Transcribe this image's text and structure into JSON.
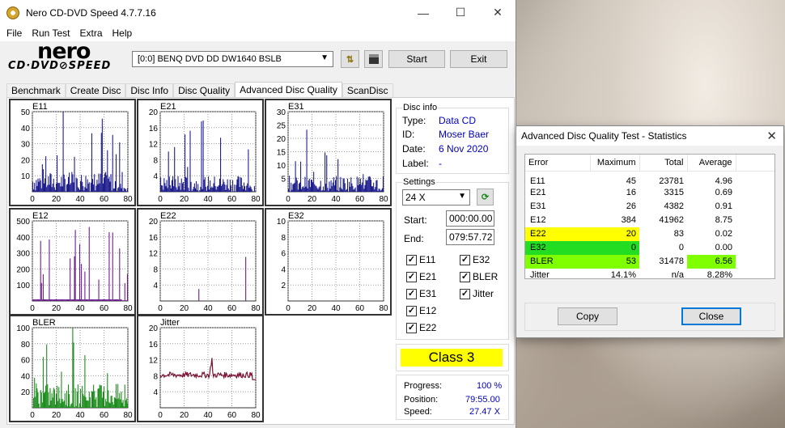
{
  "window": {
    "title": "Nero CD-DVD Speed 4.7.7.16",
    "controls": {
      "minimize": "—",
      "maximize": "☐",
      "close": "✕"
    }
  },
  "menu": [
    "File",
    "Run Test",
    "Extra",
    "Help"
  ],
  "logo": {
    "line1": "nero",
    "line2": "CD·DVD⊘SPEED"
  },
  "toolbar": {
    "drive": "[0:0]   BENQ DVD DD DW1640 BSLB",
    "start_label": "Start",
    "exit_label": "Exit"
  },
  "tabs": [
    "Benchmark",
    "Create Disc",
    "Disc Info",
    "Disc Quality",
    "Advanced Disc Quality",
    "ScanDisc"
  ],
  "active_tab": "Advanced Disc Quality",
  "disc_info": {
    "group": "Disc info",
    "type_label": "Type:",
    "type": "Data CD",
    "id_label": "ID:",
    "id": "Moser Baer",
    "date_label": "Date:",
    "date": "6 Nov 2020",
    "label_label": "Label:",
    "label": "-"
  },
  "settings": {
    "group": "Settings",
    "speed": "24 X",
    "start_label": "Start:",
    "start": "000:00.00",
    "end_label": "End:",
    "end": "079:57.72",
    "checks_left": [
      "E11",
      "E21",
      "E31",
      "E12",
      "E22"
    ],
    "checks_right": [
      "E32",
      "BLER",
      "Jitter"
    ]
  },
  "class_label": "Class 3",
  "progress": {
    "progress_label": "Progress:",
    "progress": "100 %",
    "position_label": "Position:",
    "position": "79:55.00",
    "speed_label": "Speed:",
    "speed": "27.47 X"
  },
  "chart_data": [
    {
      "type": "bar",
      "name": "E11",
      "color": "#1a1a8c",
      "xlim": [
        0,
        80
      ],
      "xticks": [
        "0",
        "20",
        "40",
        "60",
        "80"
      ],
      "ylim": [
        0,
        50
      ],
      "yticks": [
        "10",
        "20",
        "30",
        "40",
        "50"
      ]
    },
    {
      "type": "bar",
      "name": "E21",
      "color": "#1a1a8c",
      "xlim": [
        0,
        80
      ],
      "xticks": [
        "0",
        "20",
        "40",
        "60",
        "80"
      ],
      "ylim": [
        0,
        20
      ],
      "yticks": [
        "4",
        "8",
        "12",
        "16",
        "20"
      ]
    },
    {
      "type": "bar",
      "name": "E31",
      "color": "#1a1a8c",
      "xlim": [
        0,
        80
      ],
      "xticks": [
        "0",
        "20",
        "40",
        "60",
        "80"
      ],
      "ylim": [
        0,
        30
      ],
      "yticks": [
        "5",
        "10",
        "15",
        "20",
        "25",
        "30"
      ]
    },
    {
      "type": "bar",
      "name": "E12",
      "color": "#6a1a8c",
      "xlim": [
        0,
        80
      ],
      "xticks": [
        "0",
        "20",
        "40",
        "60",
        "80"
      ],
      "ylim": [
        0,
        500
      ],
      "yticks": [
        "100",
        "200",
        "300",
        "400",
        "500"
      ]
    },
    {
      "type": "bar",
      "name": "E22",
      "color": "#6a1a8c",
      "xlim": [
        0,
        80
      ],
      "xticks": [
        "0",
        "20",
        "40",
        "60",
        "80"
      ],
      "ylim": [
        0,
        20
      ],
      "yticks": [
        "4",
        "8",
        "12",
        "16",
        "20"
      ]
    },
    {
      "type": "bar",
      "name": "E32",
      "color": "#6a1a8c",
      "xlim": [
        0,
        80
      ],
      "xticks": [
        "0",
        "20",
        "40",
        "60",
        "80"
      ],
      "ylim": [
        0,
        10
      ],
      "yticks": [
        "2",
        "4",
        "6",
        "8",
        "10"
      ]
    },
    {
      "type": "bar",
      "name": "BLER",
      "color": "#1a8c1a",
      "xlim": [
        0,
        80
      ],
      "xticks": [
        "0",
        "20",
        "40",
        "60",
        "80"
      ],
      "ylim": [
        0,
        100
      ],
      "yticks": [
        "20",
        "40",
        "60",
        "80",
        "100"
      ]
    },
    {
      "type": "line",
      "name": "Jitter",
      "color": "#7a1030",
      "xlim": [
        0,
        80
      ],
      "xticks": [
        "0",
        "20",
        "40",
        "60",
        "80"
      ],
      "ylim": [
        0,
        20
      ],
      "yticks": [
        "4",
        "8",
        "12",
        "16",
        "20"
      ]
    }
  ],
  "stats_dialog": {
    "title": "Advanced Disc Quality Test - Statistics",
    "headers": [
      "Error",
      "Maximum",
      "Total",
      "Average"
    ],
    "rows": [
      {
        "error": "E11",
        "maximum": "45",
        "total": "23781",
        "average": "4.96",
        "max_bg": "",
        "avg_bg": ""
      },
      {
        "error": "E21",
        "maximum": "16",
        "total": "3315",
        "average": "0.69",
        "max_bg": "",
        "avg_bg": ""
      },
      {
        "error": "E31",
        "maximum": "26",
        "total": "4382",
        "average": "0.91",
        "max_bg": "",
        "avg_bg": ""
      },
      {
        "error": "E12",
        "maximum": "384",
        "total": "41962",
        "average": "8.75",
        "max_bg": "",
        "avg_bg": ""
      },
      {
        "error": "E22",
        "maximum": "20",
        "total": "83",
        "average": "0.02",
        "max_bg": "#ffff00",
        "avg_bg": ""
      },
      {
        "error": "E32",
        "maximum": "0",
        "total": "0",
        "average": "0.00",
        "max_bg": "#22dd22",
        "avg_bg": ""
      },
      {
        "error": "BLER",
        "maximum": "53",
        "total": "31478",
        "average": "6.56",
        "max_bg": "#7fff00",
        "avg_bg": "#7fff00"
      },
      {
        "error": "Jitter",
        "maximum": "14.1%",
        "total": "n/a",
        "average": "8.28%",
        "max_bg": "",
        "avg_bg": ""
      }
    ],
    "copy_label": "Copy",
    "close_label": "Close"
  }
}
